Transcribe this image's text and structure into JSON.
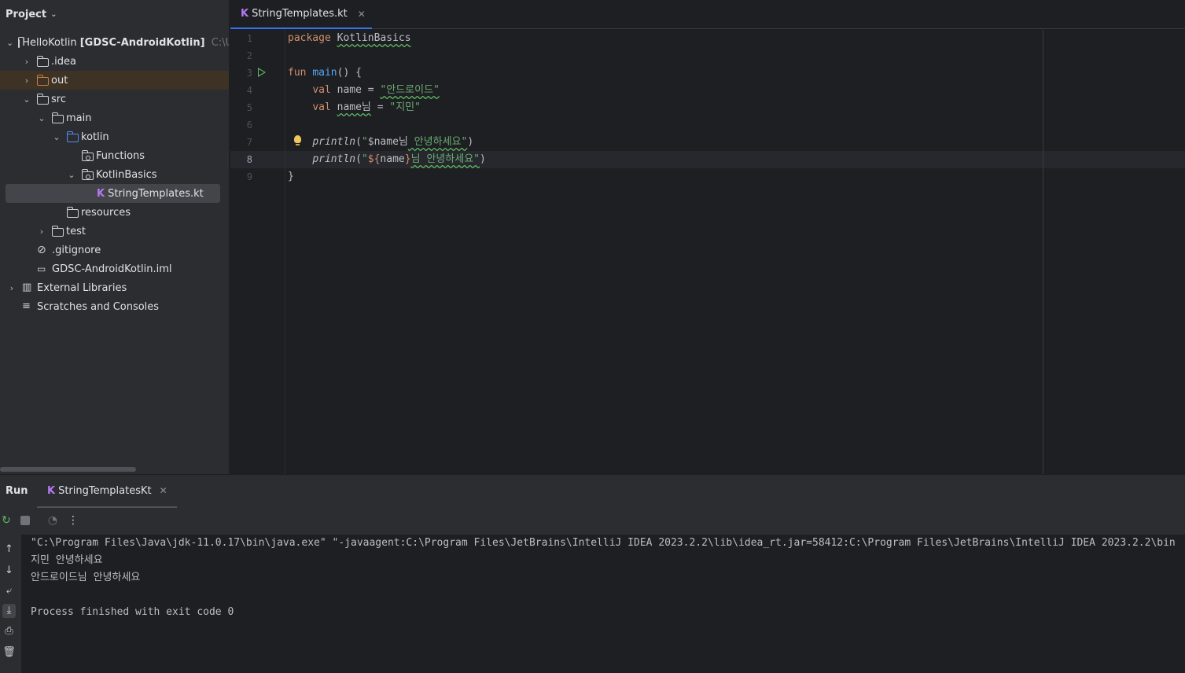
{
  "project": {
    "title": "Project",
    "tree": [
      {
        "label": "HelloKotlin",
        "bold": "[GDSC-AndroidKotlin]",
        "path": "C:\\Us"
      },
      {
        "label": ".idea"
      },
      {
        "label": "out"
      },
      {
        "label": "src"
      },
      {
        "label": "main"
      },
      {
        "label": "kotlin"
      },
      {
        "label": "Functions"
      },
      {
        "label": "KotlinBasics"
      },
      {
        "label": "StringTemplates.kt"
      },
      {
        "label": "resources"
      },
      {
        "label": "test"
      },
      {
        "label": ".gitignore"
      },
      {
        "label": "GDSC-AndroidKotlin.iml"
      },
      {
        "label": "External Libraries"
      },
      {
        "label": "Scratches and Consoles"
      }
    ]
  },
  "editor": {
    "tab_label": "StringTemplates.kt",
    "line_numbers": [
      "1",
      "2",
      "3",
      "4",
      "5",
      "6",
      "7",
      "8",
      "9"
    ],
    "code": {
      "l1_kw": "package",
      "l1_pkg": "KotlinBasics",
      "l3_kw": "fun",
      "l3_fn": "main",
      "l3_rest": "() {",
      "l4_kw": "val",
      "l4_name": "name",
      "l4_eq": " = ",
      "l4_str": "\"안드로이드\"",
      "l5_kw": "val",
      "l5_name": "name님",
      "l5_eq": " = ",
      "l5_str": "\"지민\"",
      "l7_call": "println",
      "l7_open": "(",
      "l7_q": "\"",
      "l7_tpl": "$name님",
      "l7_str": " 안녕하세요\"",
      "l7_close": ")",
      "l8_call": "println",
      "l8_open": "(",
      "l8_q": "\"",
      "l8_tpl_open": "${",
      "l8_tpl_name": "name",
      "l8_tpl_close": "}",
      "l8_str": "님 안녕하세요\"",
      "l8_close": ")",
      "l9": "}"
    }
  },
  "run": {
    "title": "Run",
    "tab_label": "StringTemplatesKt",
    "output": [
      "\"C:\\Program Files\\Java\\jdk-11.0.17\\bin\\java.exe\" \"-javaagent:C:\\Program Files\\JetBrains\\IntelliJ IDEA 2023.2.2\\lib\\idea_rt.jar=58412:C:\\Program Files\\JetBrains\\IntelliJ IDEA 2023.2.2\\bin",
      "지민 안녕하세요",
      "안드로이드님 안녕하세요",
      "",
      "Process finished with exit code 0"
    ]
  },
  "colors": {
    "accent": "#3574f0",
    "keyword": "#cf8e6d",
    "function": "#56a8f5",
    "string": "#6aab73",
    "kotlin_icon": "#b479f2"
  }
}
